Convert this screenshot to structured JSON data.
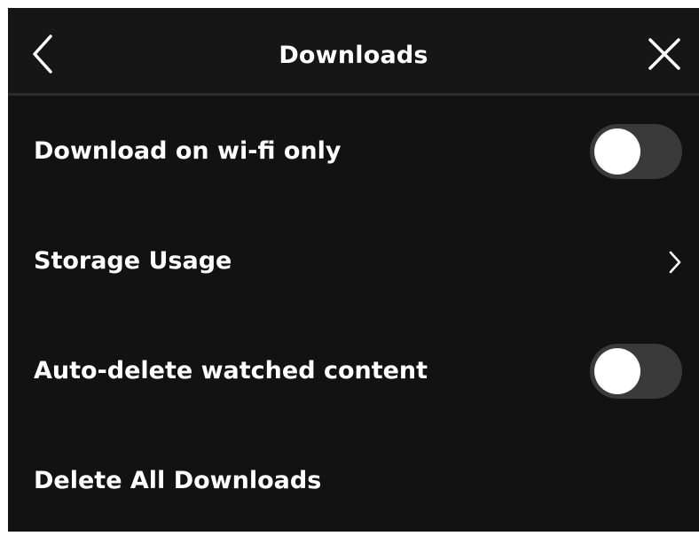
{
  "header": {
    "title": "Downloads",
    "back_icon": "chevron-left-icon",
    "close_icon": "close-icon"
  },
  "settings": [
    {
      "label": "Download on wi-fi only",
      "control": "toggle",
      "enabled": false
    },
    {
      "label": "Storage Usage",
      "control": "chevron-right-icon"
    },
    {
      "label": "Auto-delete watched content",
      "control": "toggle",
      "enabled": false
    },
    {
      "label": "Delete All Downloads",
      "control": "none"
    }
  ],
  "colors": {
    "background": "#121212",
    "header_background": "#161616",
    "divider": "#2c2c2c",
    "text": "#ffffff",
    "toggle_track_off": "#3a3a3a",
    "toggle_knob": "#ffffff"
  }
}
